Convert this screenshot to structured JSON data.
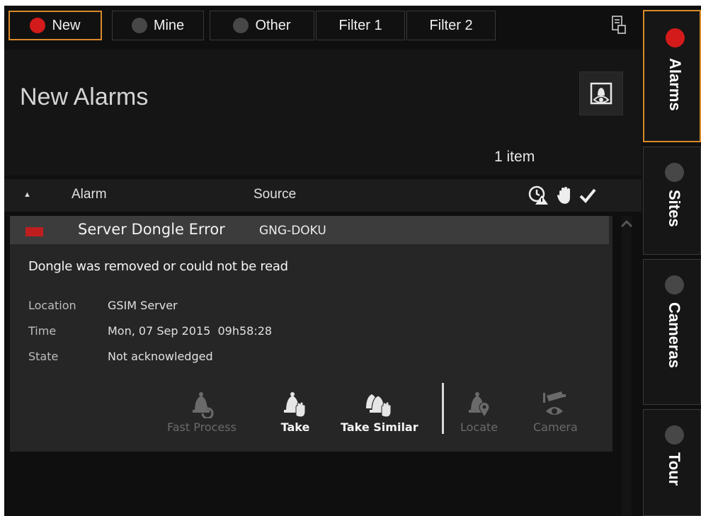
{
  "filter_tabs": [
    {
      "label": "New",
      "dot": "red",
      "active": true
    },
    {
      "label": "Mine",
      "dot": "gray",
      "active": false
    },
    {
      "label": "Other",
      "dot": "gray",
      "active": false
    },
    {
      "label": "Filter 1",
      "active": false
    },
    {
      "label": "Filter 2",
      "active": false
    }
  ],
  "header": {
    "title": "New Alarms",
    "item_count": "1 item"
  },
  "columns": {
    "alarm": "Alarm",
    "source": "Source",
    "sort_indicator": "▲"
  },
  "alarm": {
    "name": "Server Dongle Error",
    "source": "GNG-DOKU",
    "severity_color": "#c01e1e",
    "description": "Dongle was removed or could not be read",
    "details": [
      {
        "label": "Location",
        "value": "GSIM Server"
      },
      {
        "label": "Time",
        "value": "Mon, 07 Sep 2015  09h58:28"
      },
      {
        "label": "State",
        "value": "Not acknowledged"
      }
    ],
    "actions": [
      {
        "label": "Fast Process",
        "enabled": false
      },
      {
        "label": "Take",
        "enabled": true
      },
      {
        "label": "Take Similar",
        "enabled": true
      },
      {
        "label": "Locate",
        "enabled": false
      },
      {
        "label": "Camera",
        "enabled": false
      }
    ]
  },
  "side_tabs": [
    {
      "label": "Alarms",
      "dot": "red",
      "active": true
    },
    {
      "label": "Sites",
      "dot": "gray",
      "active": false
    },
    {
      "label": "Cameras",
      "dot": "gray",
      "active": false
    },
    {
      "label": "Tour",
      "dot": "gray",
      "active": false
    }
  ],
  "colors": {
    "accent_border": "#d88a2a",
    "alarm_red": "#d41b1b",
    "background": "#0f0f0f"
  }
}
